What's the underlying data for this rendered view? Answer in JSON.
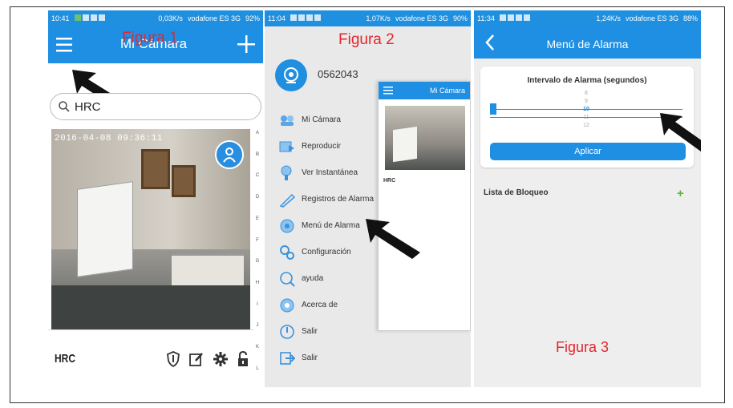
{
  "panel1": {
    "status": {
      "time": "10:41",
      "net": "0,03K/s",
      "carrier": "vodafone ES 3G",
      "battery": "92%"
    },
    "title": "Mi Cámara",
    "figure_label": "Figura 1",
    "search": {
      "value": "HRC"
    },
    "camera": {
      "timestamp": "2016-04-08 09:36:11",
      "name": "HRC"
    },
    "alphabet": [
      "A",
      "B",
      "C",
      "D",
      "E",
      "F",
      "G",
      "H",
      "I",
      "J",
      "K",
      "L"
    ]
  },
  "panel2": {
    "status": {
      "time": "11:04",
      "net": "1,07K/s",
      "carrier": "vodafone ES 3G",
      "battery": "90%"
    },
    "figure_label": "Figura 2",
    "account_id": "0562043",
    "menu": [
      {
        "label": "Mi Cámara",
        "icon": "camera-icon"
      },
      {
        "label": "Reproducir",
        "icon": "play-icon"
      },
      {
        "label": "Ver Instantánea",
        "icon": "snapshot-icon"
      },
      {
        "label": "Registros de Alarma",
        "icon": "alarm-log-icon"
      },
      {
        "label": "Menú de Alarma",
        "icon": "alarm-menu-icon"
      },
      {
        "label": "Configuración",
        "icon": "settings-icon"
      },
      {
        "label": "ayuda",
        "icon": "help-icon"
      },
      {
        "label": "Acerca de",
        "icon": "about-icon"
      },
      {
        "label": "Salir",
        "icon": "power-icon"
      },
      {
        "label": "Salir",
        "icon": "exit-icon"
      }
    ],
    "preview": {
      "title": "Mi Cámara",
      "camera_name": "HRC"
    }
  },
  "panel3": {
    "status": {
      "time": "11:34",
      "net": "1,24K/s",
      "carrier": "vodafone ES 3G",
      "battery": "88%"
    },
    "title": "Menú de Alarma",
    "figure_label": "Figura 3",
    "interval_title": "Intervalo de Alarma (segundos)",
    "picker_values": [
      "8",
      "9",
      "10",
      "11",
      "12"
    ],
    "picker_selected": "10",
    "apply_label": "Aplicar",
    "block_list_label": "Lista de Bloqueo"
  },
  "colors": {
    "brand": "#1e8fe3",
    "annotation_red": "#e3262c",
    "add_green": "#58b73b"
  }
}
